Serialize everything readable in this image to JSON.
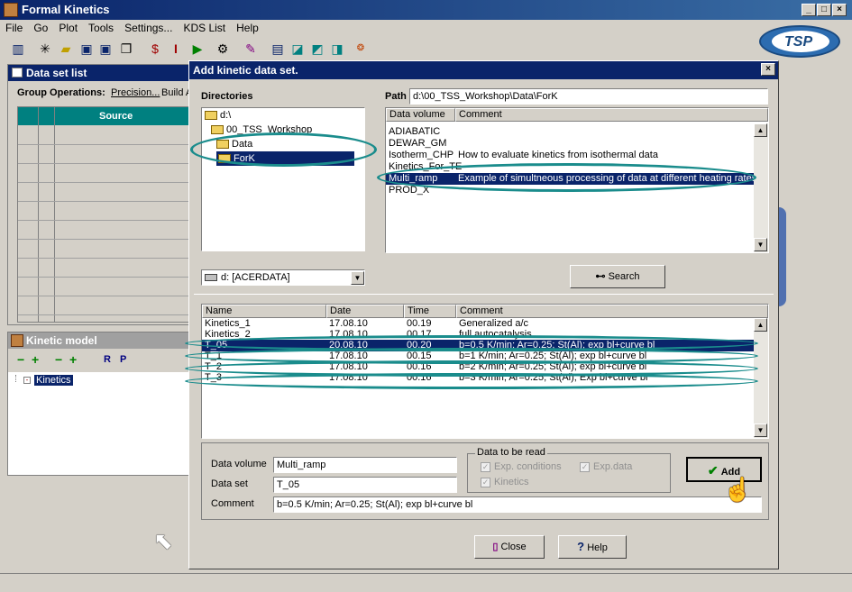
{
  "app": {
    "title": "Formal Kinetics"
  },
  "menu": [
    "File",
    "Go",
    "Plot",
    "Tools",
    "Settings...",
    "KDS List",
    "Help"
  ],
  "logo": "TSP",
  "dataset_panel": {
    "title": "Data set list",
    "group_ops": "Group Operations:",
    "precision": "Precision...",
    "build": "Build A",
    "col_source": "Source"
  },
  "kinetic_panel": {
    "title": "Kinetic model",
    "r": "R",
    "p": "P",
    "tree_root": "Kinetics"
  },
  "dialog": {
    "title": "Add kinetic data set.",
    "directories_label": "Directories",
    "path_label": "Path",
    "path_value": "d:\\00_TSS_Workshop\\Data\\ForK",
    "dirs": [
      "d:\\",
      "00_TSS_Workshop",
      "Data",
      "ForK"
    ],
    "drive": "d: [ACERDATA]",
    "volume_headers": [
      "Data volume",
      "Comment"
    ],
    "volumes": [
      {
        "name": "ADIABATIC",
        "comment": ""
      },
      {
        "name": "DEWAR_GM",
        "comment": ""
      },
      {
        "name": "Isotherm_CHP",
        "comment": "How to evaluate  kinetics from isothermal data"
      },
      {
        "name": "Kinetics_For_TE",
        "comment": ""
      },
      {
        "name": "Multi_ramp",
        "comment": "Example of simultneous processing of data at different heating rates - DT"
      },
      {
        "name": "PROD_X",
        "comment": ""
      }
    ],
    "search_label": "Search",
    "set_headers": [
      "Name",
      "Date",
      "Time",
      "Comment"
    ],
    "sets": [
      {
        "name": "Kinetics_1",
        "date": "17.08.10",
        "time": "00.19",
        "comment": "Generalized a/c"
      },
      {
        "name": "Kinetics_2",
        "date": "17.08.10",
        "time": "00.17",
        "comment": "full autocatalysis"
      },
      {
        "name": "T_05",
        "date": "20.08.10",
        "time": "00.20",
        "comment": "b=0.5 K/min; Ar=0.25; St(Al); exp bl+curve bl"
      },
      {
        "name": "T_1",
        "date": "17.08.10",
        "time": "00.15",
        "comment": "b=1 K/min; Ar=0.25; St(Al); exp bl+curve bl"
      },
      {
        "name": "T_2",
        "date": "17.08.10",
        "time": "00.16",
        "comment": "b=2 K/min; Ar=0.25; St(Al); exp bl+curve bl"
      },
      {
        "name": "T_3",
        "date": "17.08.10",
        "time": "00.16",
        "comment": "b=3 K/min; Ar=0.25; St(Al); Exp bl+curve bl"
      }
    ],
    "form": {
      "volume_label": "Data volume",
      "volume_value": "Multi_ramp",
      "set_label": "Data set",
      "set_value": "T_05",
      "comment_label": "Comment",
      "comment_value": "b=0.5 K/min; Ar=0.25; St(Al); exp bl+curve bl"
    },
    "read_group": {
      "title": "Data to be read",
      "exp_conditions": "Exp. conditions",
      "exp_data": "Exp.data",
      "kinetics": "Kinetics"
    },
    "add_label": "Add",
    "close_label": "Close",
    "help_label": "Help"
  },
  "colors": {
    "title_bar": "#0a246a",
    "highlight": "#1a8c8c",
    "teal_header": "#008080"
  }
}
